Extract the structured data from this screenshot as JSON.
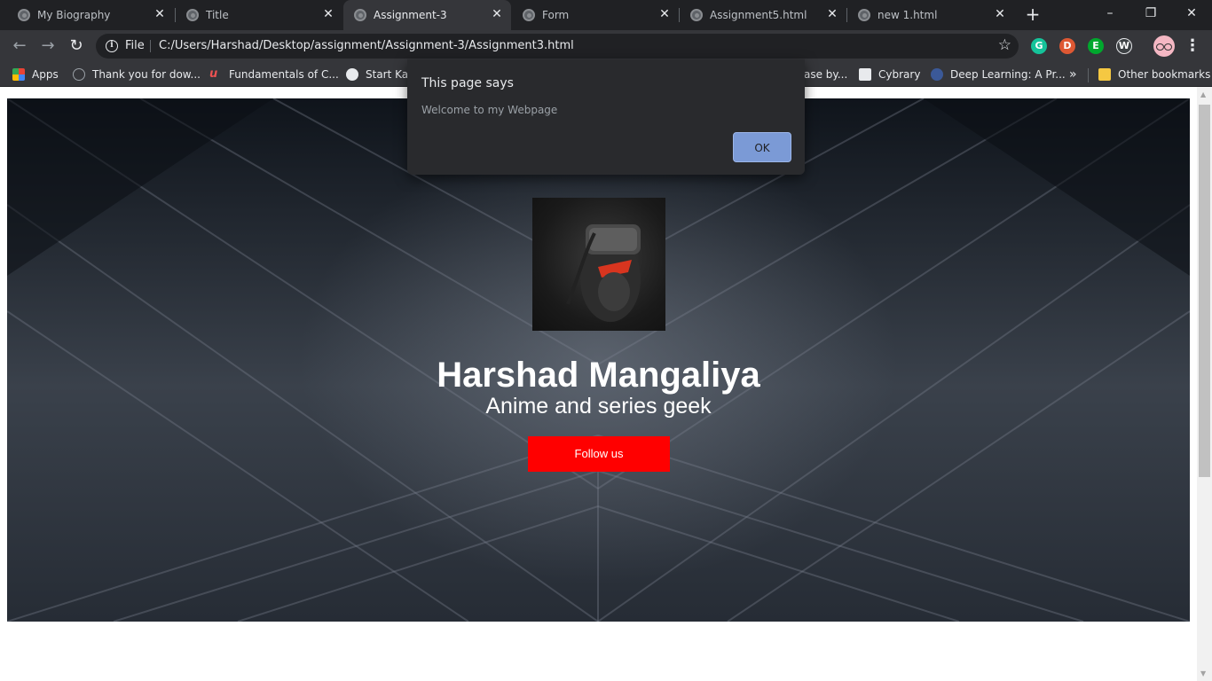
{
  "browser": {
    "tabs": [
      {
        "title": "My Biography",
        "active": false
      },
      {
        "title": "Title",
        "active": false
      },
      {
        "title": "Assignment-3",
        "active": true
      },
      {
        "title": "Form",
        "active": false
      },
      {
        "title": "Assignment5.html",
        "active": false
      },
      {
        "title": "new 1.html",
        "active": false
      }
    ],
    "tab_close_glyph": "✕",
    "new_tab_glyph": "+",
    "window_controls": {
      "minimize": "–",
      "restore": "❐",
      "close": "✕"
    },
    "toolbar": {
      "back_glyph": "←",
      "forward_glyph": "→",
      "reload_glyph": "↻",
      "scheme_label": "File",
      "url": "C:/Users/Harshad/Desktop/assignment/Assignment-3/Assignment3.html",
      "star_glyph": "☆",
      "menu_glyph": "⋮",
      "extensions": [
        {
          "name": "grammarly-icon",
          "letter": "G",
          "color": "#15c39a"
        },
        {
          "name": "duckduckgo-icon",
          "letter": "D",
          "color": "#de5833"
        },
        {
          "name": "evernote-icon",
          "letter": "E",
          "color": "#00a82d"
        },
        {
          "name": "wordtune-icon",
          "letter": "W",
          "color": "#3c4043"
        }
      ]
    },
    "bookmarks": [
      {
        "label": "Apps",
        "icon": "apps-icon"
      },
      {
        "label": "Thank you for dow...",
        "icon": "page-icon"
      },
      {
        "label": "Fundamentals of C...",
        "icon": "udemy-icon"
      },
      {
        "label": "Start Kali",
        "icon": "globe-icon"
      },
      {
        "label": "ase by...",
        "icon": "page-icon"
      },
      {
        "label": "Cybrary",
        "icon": "cybrary-icon"
      },
      {
        "label": "Deep Learning: A Pr...",
        "icon": "book-icon"
      }
    ],
    "bookmarks_overflow_glyph": "»",
    "other_bookmarks_label": "Other bookmarks"
  },
  "page": {
    "name": "Harshad Mangaliya",
    "tagline": "Anime and series geek",
    "follow_label": "Follow us"
  },
  "alert": {
    "title": "This page says",
    "message": "Welcome to my Webpage",
    "ok_label": "OK"
  },
  "colors": {
    "follow_button": "#ff0000",
    "ok_button": "#7b9ad6",
    "chrome_dark": "#202124",
    "toolbar": "#35363a"
  }
}
